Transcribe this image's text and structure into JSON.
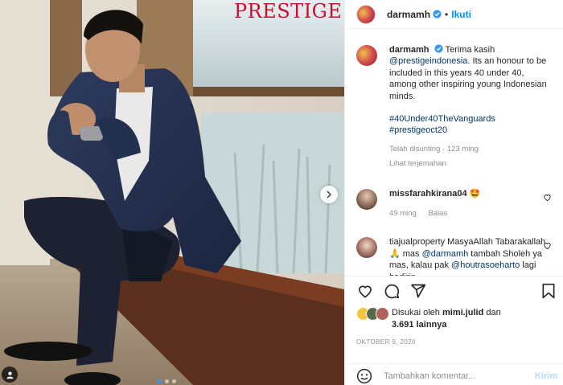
{
  "photo": {
    "brand": "PRESTIGE",
    "carousel_dots": [
      true,
      false,
      false
    ]
  },
  "post": {
    "username": "darmamh",
    "follow_label": "Ikuti"
  },
  "caption": {
    "username": "darmamh",
    "text": "Terima kasih",
    "mention": "@prestigeindonesia.",
    "body": "Its an honour to be included in this years 40 under 40, among other inspiring young Indonesian minds.",
    "hashtag1": "#40Under40TheVanguards",
    "hashtag2": "#prestigeoct20",
    "meta": "Telah disunting · 123 ming",
    "translate": "Lihat terjemahan"
  },
  "comments": [
    {
      "username": "missfarahkirana04",
      "text": "🤩",
      "age": "49 ming",
      "reply_label": "Balas"
    },
    {
      "username": "tiajualproperty",
      "text_a": "MasyaAllah Tabarakallah 🙏 mas ",
      "mention": "@darmamh",
      "text_b": " tambah Sholeh ya mas, kalau pak ",
      "mention2": "@houtrasoeharto",
      "text_c": " lagi hadirin"
    }
  ],
  "likes": {
    "prefix": "Disukai oleh ",
    "user": "mimi.julid",
    "suffix": " dan",
    "count": "3.691 lainnya"
  },
  "date": "OKTOBER 9, 2020",
  "add_comment": {
    "placeholder": "Tambahkan komentar...",
    "post_label": "Kirim"
  },
  "colors": {
    "accent": "#0095f6",
    "brand_red": "#c7102e"
  }
}
